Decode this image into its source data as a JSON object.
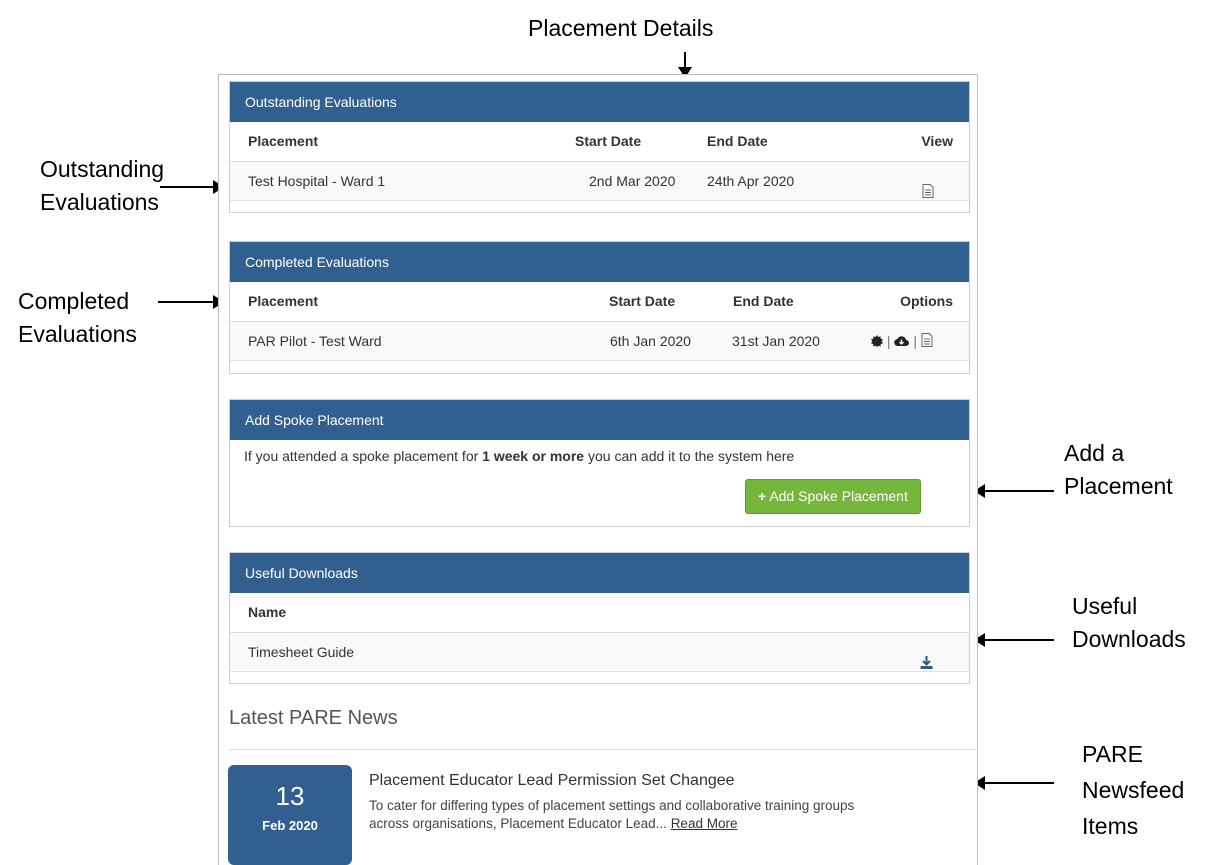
{
  "annotations": {
    "placement_details": "Placement Details",
    "outstanding_line1": "Outstanding",
    "outstanding_line2": "Evaluations",
    "completed_line1": "Completed",
    "completed_line2": "Evaluations",
    "add_line1": "Add a",
    "add_line2": "Placement",
    "useful_line1": "Useful",
    "useful_line2": "Downloads",
    "pare_line1": "PARE",
    "pare_line2": "Newsfeed",
    "pare_line3": "Items"
  },
  "outstanding": {
    "title": "Outstanding Evaluations",
    "headers": {
      "placement": "Placement",
      "start": "Start Date",
      "end": "End Date",
      "view": "View"
    },
    "rows": [
      {
        "placement": "Test Hospital - Ward 1",
        "start": "2nd Mar 2020",
        "end": "24th Apr 2020",
        "icon": "document-icon"
      }
    ]
  },
  "completed": {
    "title": "Completed Evaluations",
    "headers": {
      "placement": "Placement",
      "start": "Start Date",
      "end": "End Date",
      "options": "Options"
    },
    "rows": [
      {
        "placement": "PAR Pilot - Test Ward",
        "start": "6th Jan 2020",
        "end": "31st Jan 2020",
        "separator": "|"
      }
    ]
  },
  "spoke": {
    "title": "Add Spoke Placement",
    "text_before": "If you attended a spoke placement for ",
    "text_bold": "1 week or more",
    "text_after": " you can add it to the system here",
    "button_label": "Add Spoke Placement",
    "button_icon": "+"
  },
  "downloads": {
    "title": "Useful Downloads",
    "header_name": "Name",
    "rows": [
      {
        "name": "Timesheet Guide",
        "icon": "download-icon"
      }
    ]
  },
  "news": {
    "heading": "Latest PARE News",
    "items": [
      {
        "day": "13",
        "month_year": "Feb 2020",
        "title": "Placement Educator Lead Permission Set Changee",
        "body_line1": "To cater for differing types of placement settings and collaborative training groups",
        "body_line2": "across organisations, Placement Educator Lead...",
        "read_more": "Read More"
      }
    ]
  },
  "colors": {
    "header_blue": "#315f8f",
    "button_green": "#74b73b"
  }
}
